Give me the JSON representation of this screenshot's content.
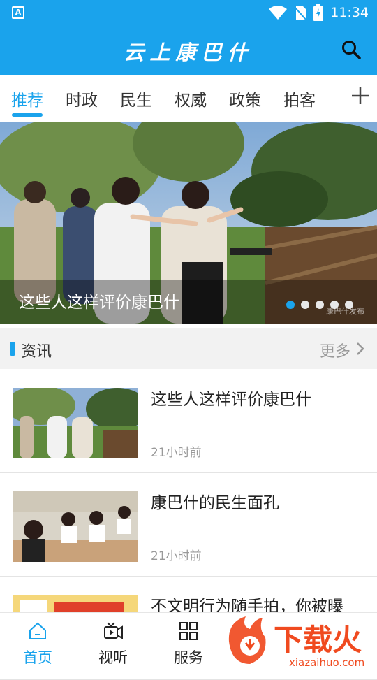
{
  "status_bar": {
    "time": "11:34"
  },
  "header": {
    "title": "云上康巴什"
  },
  "tabs": [
    {
      "label": "推荐",
      "active": true
    },
    {
      "label": "时政"
    },
    {
      "label": "民生"
    },
    {
      "label": "权威"
    },
    {
      "label": "政策"
    },
    {
      "label": "拍客"
    }
  ],
  "banner": {
    "caption": "这些人这样评价康巴什",
    "watermark": "康巴什发布",
    "slide_count": 5,
    "active_slide": 1
  },
  "section": {
    "title": "资讯",
    "more_label": "更多"
  },
  "news": [
    {
      "title": "这些人这样评价康巴什",
      "time": "21小时前"
    },
    {
      "title": "康巴什的民生面孔",
      "time": "21小时前"
    },
    {
      "title": "不文明行为随手拍，你被曝",
      "time": ""
    }
  ],
  "bottom_nav": [
    {
      "label": "首页",
      "active": true
    },
    {
      "label": "视听"
    },
    {
      "label": "服务"
    },
    {
      "label": ""
    },
    {
      "label": ""
    }
  ],
  "overlay_watermark": {
    "text": "下载火",
    "url_text": "xiazaihuo.com"
  },
  "colors": {
    "accent": "#1aa3ec",
    "watermark_orange": "#f04a1f"
  }
}
